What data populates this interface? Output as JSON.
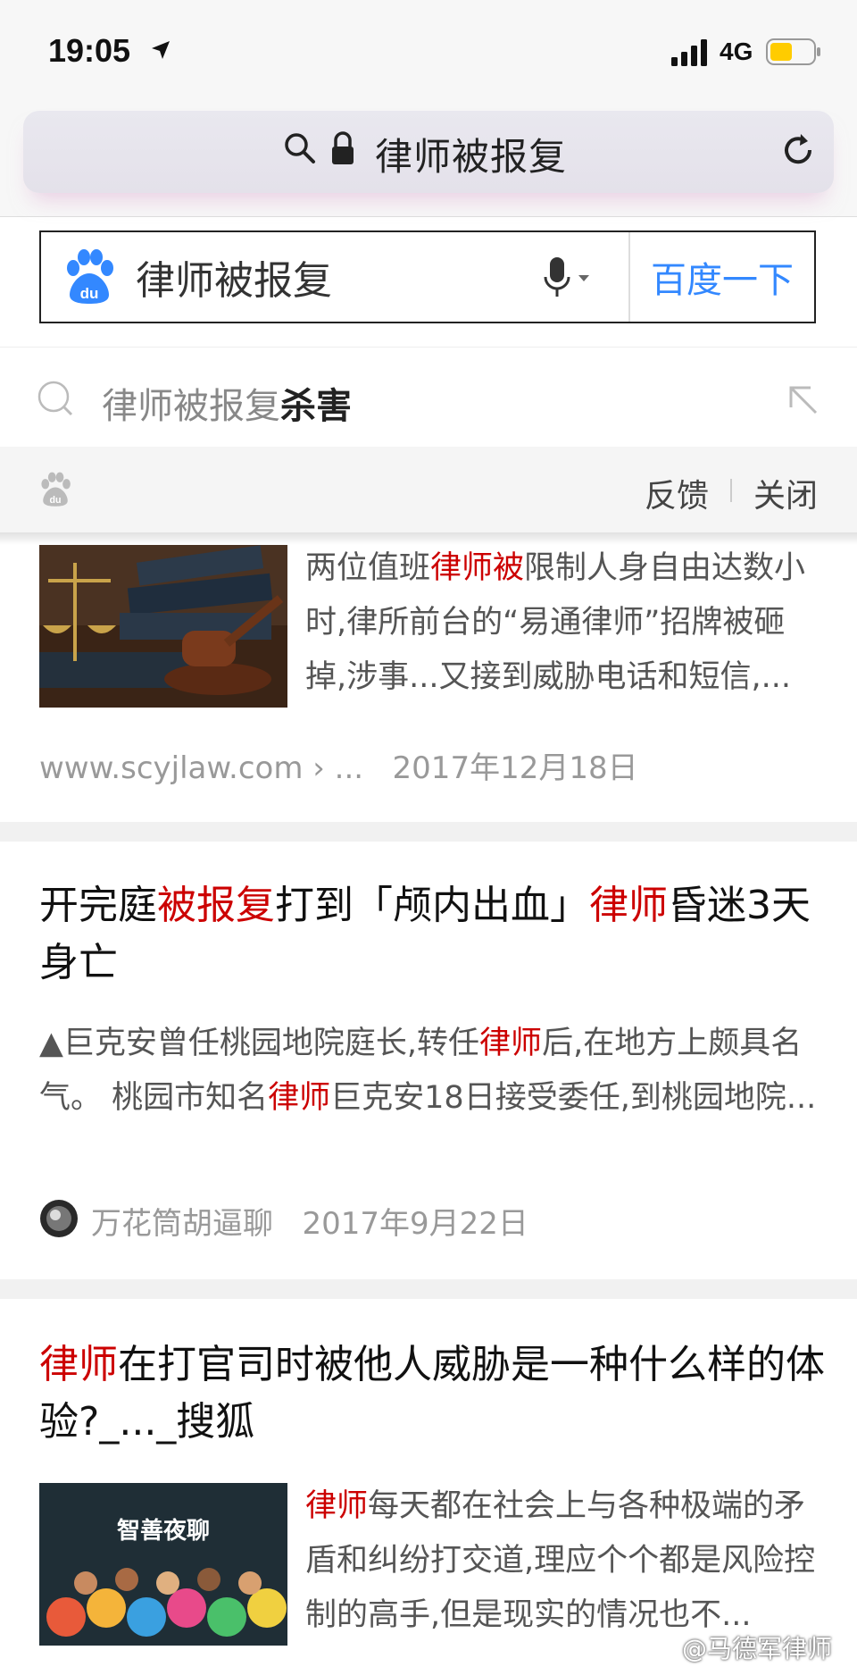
{
  "status_bar": {
    "time": "19:05",
    "network": "4G",
    "icons": [
      "location-arrow-icon",
      "signal-icon",
      "battery-icon"
    ],
    "battery_color": "#ffcc00"
  },
  "url_bar": {
    "text": "律师被报复",
    "icons": [
      "search-icon",
      "lock-icon",
      "reload-icon"
    ]
  },
  "search": {
    "query": "律师被报复",
    "button_label": "百度一下",
    "accent": "#3388ff"
  },
  "suggestion": {
    "prefix": "律师被报复",
    "suffix": "杀害"
  },
  "feedback_bar": {
    "feedback": "反馈",
    "close": "关闭"
  },
  "results": [
    {
      "snippet": [
        {
          "t": "两位值班"
        },
        {
          "t": "律师被",
          "hl": true
        },
        {
          "t": "限制人身自由达数小时,律所前台的“易通律师”招牌被砸掉,涉事...又接到威胁电话和短信,..."
        }
      ],
      "source": "www.scyjlaw.com › ...",
      "date": "2017年12月18日"
    },
    {
      "title": [
        {
          "t": "开完庭"
        },
        {
          "t": "被报复",
          "hl": true
        },
        {
          "t": "打到「颅内出血」"
        },
        {
          "t": "律师",
          "hl": true
        },
        {
          "t": "昏迷3天身亡"
        }
      ],
      "snippet": [
        {
          "t": "▲巨克安曾任桃园地院庭长,转任"
        },
        {
          "t": "律师",
          "hl": true
        },
        {
          "t": "后,在地方上颇具名气。 桃园市知名"
        },
        {
          "t": "律师",
          "hl": true
        },
        {
          "t": "巨克安18日接受委任,到桃园地院..."
        }
      ],
      "source": "万花筒胡逼聊",
      "date": "2017年9月22日"
    },
    {
      "title": [
        {
          "t": "律师",
          "hl": true
        },
        {
          "t": "在打官司时被他人威胁是一种什么样的体验?_..._搜狐"
        }
      ],
      "thumb_text": "智善夜聊",
      "snippet": [
        {
          "t": "律师",
          "hl": true
        },
        {
          "t": "每天都在社会上与各种极端的矛盾和纠纷打交道,理应个个都是风险控制的高手,但是现实的情况也不..."
        }
      ]
    }
  ],
  "highlight_color": "#cc0000",
  "watermark": "@马德军律师"
}
